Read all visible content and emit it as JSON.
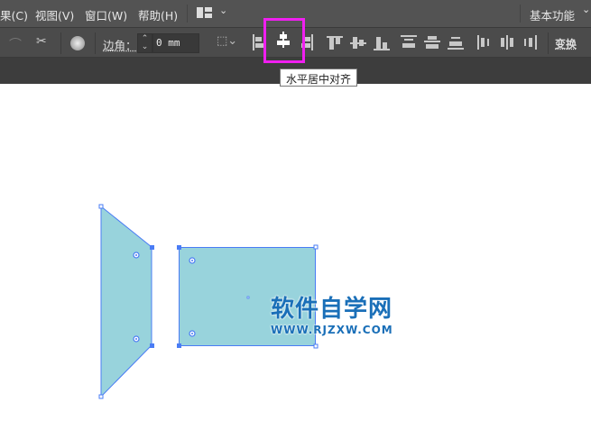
{
  "menu": {
    "items": [
      "果(C)",
      "视图(V)",
      "窗口(W)",
      "帮助(H)"
    ],
    "workspace": "基本功能"
  },
  "toolbar": {
    "corner_label": "边角：",
    "corner_value": "0 mm",
    "transform_label": "变换"
  },
  "tooltip": "水平居中对齐",
  "watermark": {
    "title": "软件自学网",
    "url": "WWW.RJZXW.COM"
  },
  "colors": {
    "fill": "#98d3dc",
    "selection": "#4a7cf5",
    "highlight": "#f01ff0"
  }
}
